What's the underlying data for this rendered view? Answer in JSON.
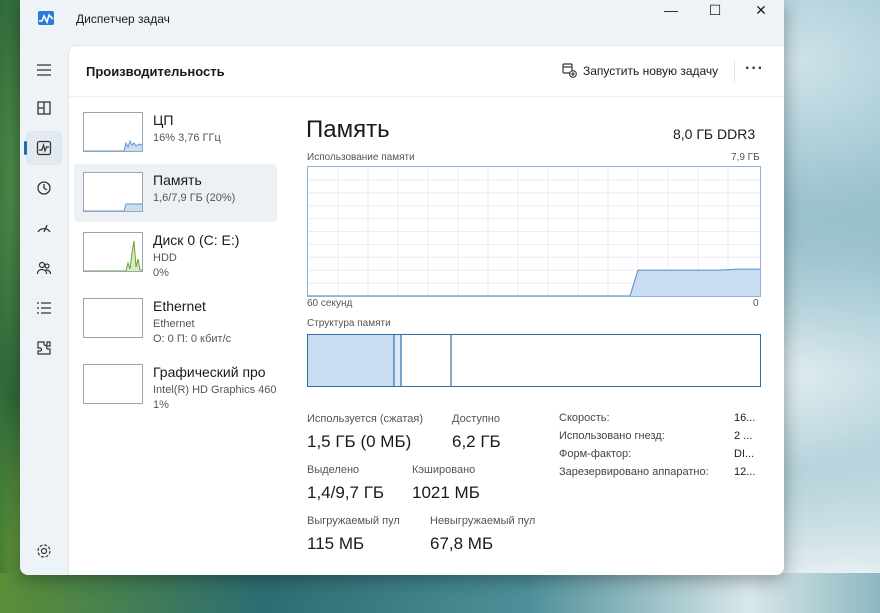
{
  "window": {
    "title": "Диспетчер задач",
    "minimize_glyph": "—",
    "maximize_glyph": "☐",
    "close_glyph": "✕"
  },
  "nav": {
    "items": [
      {
        "icon": "hamburger-menu-icon"
      },
      {
        "icon": "processes-icon"
      },
      {
        "icon": "performance-icon",
        "active": true
      },
      {
        "icon": "app-history-icon"
      },
      {
        "icon": "startup-apps-icon"
      },
      {
        "icon": "users-icon"
      },
      {
        "icon": "details-icon"
      },
      {
        "icon": "services-icon"
      },
      {
        "icon": "settings-icon"
      }
    ]
  },
  "header": {
    "title": "Производительность",
    "run_task_label": "Запустить новую задачу",
    "more_label": "···"
  },
  "resources": [
    {
      "name": "ЦП",
      "line1": "16% 3,76 ГГц",
      "line2": ""
    },
    {
      "name": "Память",
      "line1": "1,6/7,9 ГБ (20%)",
      "line2": ""
    },
    {
      "name": "Диск 0 (C: E:)",
      "line1": "HDD",
      "line2": "0%"
    },
    {
      "name": "Ethernet",
      "line1": "Ethernet",
      "line2": "О: 0 П: 0 кбит/с"
    },
    {
      "name": "Графический про",
      "line1": "Intel(R) HD Graphics 460",
      "line2": "1%"
    }
  ],
  "memory": {
    "title": "Память",
    "type": "8,0 ГБ DDR3",
    "usage_label": "Использование памяти",
    "usage_max": "7,9 ГБ",
    "time_left": "60 секунд",
    "time_right": "0",
    "structure_label": "Структура памяти",
    "usage_fraction": 0.2,
    "stats": {
      "in_use_label": "Используется (сжатая)",
      "in_use_value": "1,5 ГБ (0 МБ)",
      "available_label": "Доступно",
      "available_value": "6,2 ГБ",
      "committed_label": "Выделено",
      "committed_value": "1,4/9,7 ГБ",
      "cached_label": "Кэшировано",
      "cached_value": "1021 МБ",
      "paged_label": "Выгружаемый пул",
      "paged_value": "115 МБ",
      "nonpaged_label": "Невыгружаемый пул",
      "nonpaged_value": "67,8 МБ"
    },
    "specs": {
      "speed_label": "Скорость:",
      "speed_value": "16...",
      "slots_label": "Использовано гнезд:",
      "slots_value": "2 ...",
      "form_label": "Форм-фактор:",
      "form_value": "DI...",
      "reserved_label": "Зарезервировано аппаратно:",
      "reserved_value": "12..."
    }
  },
  "colors": {
    "accent": "#1f6fb5",
    "graph_fill": "#c8dcf2",
    "graph_line": "#5f97cf",
    "disk_line": "#6a9f2f",
    "window_bg": "#eef3f7"
  }
}
